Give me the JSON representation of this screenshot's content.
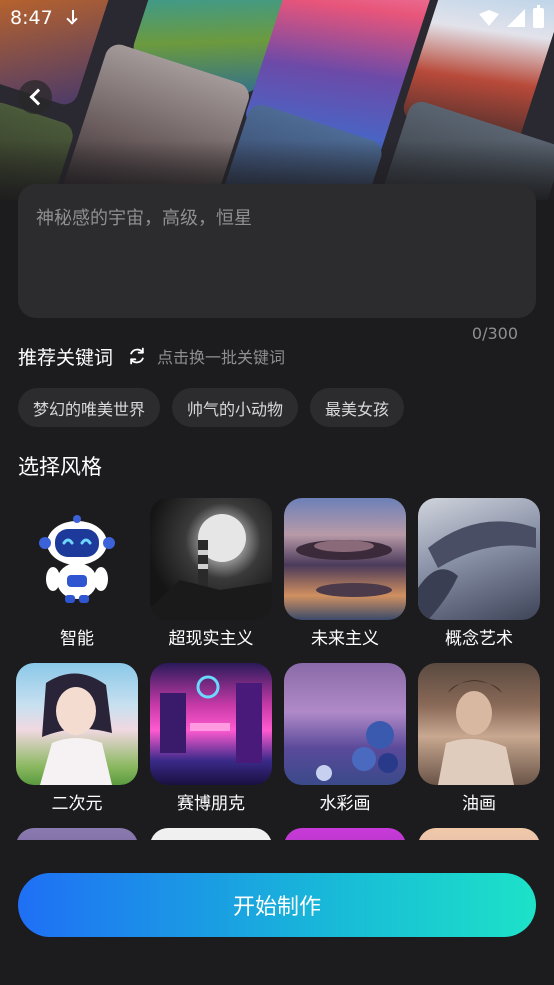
{
  "status_bar": {
    "time": "8:47"
  },
  "prompt": {
    "text": "神秘感的宇宙，高级，恒星",
    "counter": "0/300"
  },
  "keywords": {
    "title": "推荐关键词",
    "hint": "点击换一批关键词",
    "chips": [
      "梦幻的唯美世界",
      "帅气的小动物",
      "最美女孩"
    ]
  },
  "styles": {
    "title": "选择风格",
    "items": [
      {
        "label": "智能"
      },
      {
        "label": "超现实主义"
      },
      {
        "label": "未来主义"
      },
      {
        "label": "概念艺术"
      },
      {
        "label": "二次元"
      },
      {
        "label": "赛博朋克"
      },
      {
        "label": "水彩画"
      },
      {
        "label": "油画"
      }
    ]
  },
  "start_button": {
    "label": "开始制作"
  },
  "colors": {
    "background": "#1c1c1e",
    "card": "#2c2c2e",
    "accent_start": "#1f6ff5",
    "accent_end": "#1de2c8"
  }
}
